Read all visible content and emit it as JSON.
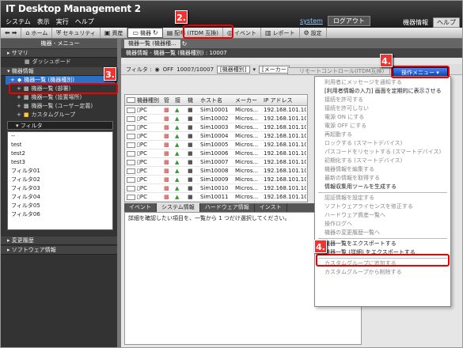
{
  "app": {
    "title": "IT Desktop Management 2",
    "menu": [
      "システム",
      "表示",
      "実行",
      "ヘルプ"
    ],
    "user": "system",
    "logout": "ログアウト",
    "device_info": "機器情報",
    "help": "ヘルプ"
  },
  "toolbar": {
    "home": "ホーム",
    "security": "セキュリティ",
    "assets": "資産",
    "devices": "機器",
    "distribution": "配布 (ITDM 互換)",
    "events": "イベント",
    "reports": "レポート",
    "settings": "設定"
  },
  "sidebar": {
    "header": "機器 - メニュー",
    "summary": "サマリ",
    "dashboard": "ダッシュボード",
    "device_info_section": "機器情報",
    "items": [
      {
        "label": "機器一覧 (機器種別)"
      },
      {
        "label": "機器一覧 (部署)"
      },
      {
        "label": "機器一覧 (設置場所)"
      },
      {
        "label": "機器一覧 (ユーザー定義)"
      },
      {
        "label": "カスタムグループ"
      }
    ],
    "filter_label": "フィルタ",
    "filters": [
      "--",
      "test",
      "test2",
      "test3",
      "フィルタ01",
      "フィルタ02",
      "フィルタ03",
      "フィルタ04",
      "フィルタ05",
      "フィルタ06"
    ],
    "change_history": "変更履歴",
    "software_info": "ソフトウェア情報"
  },
  "main": {
    "tab": "機器一覧 (機器種...",
    "info": "機器情報 - 機器一覧 (機器種別) : 10007",
    "filter_label": "フィルタ :",
    "filter_state": "OFF",
    "count": "10007/10007",
    "group": "[機器種別]",
    "maker": "[メーカー",
    "remote": "リモートコントロール(ITDM互換)",
    "op_menu": "操作メニュー",
    "columns": [
      "機器種別",
      "管",
      "接",
      "機",
      "ホスト名",
      "メーカー",
      "IP アドレス"
    ],
    "rows": [
      [
        "PC",
        "Sim10001",
        "Micros...",
        "192.168.101.10"
      ],
      [
        "PC",
        "Sim10002",
        "Micros...",
        "192.168.101.10"
      ],
      [
        "PC",
        "Sim10003",
        "Micros...",
        "192.168.101.10"
      ],
      [
        "PC",
        "Sim10004",
        "Micros...",
        "192.168.101.10"
      ],
      [
        "PC",
        "Sim10005",
        "Micros...",
        "192.168.101.10"
      ],
      [
        "PC",
        "Sim10006",
        "Micros...",
        "192.168.101.10"
      ],
      [
        "PC",
        "Sim10007",
        "Micros...",
        "192.168.101.10"
      ],
      [
        "PC",
        "Sim10008",
        "Micros...",
        "192.168.101.10"
      ],
      [
        "PC",
        "Sim10009",
        "Micros...",
        "192.168.101.10"
      ],
      [
        "PC",
        "Sim10010",
        "Micros...",
        "192.168.101.10"
      ],
      [
        "PC",
        "Sim10011",
        "Micros...",
        "192.168.101.10"
      ]
    ],
    "bottom_tabs": [
      "イベント",
      "システム情報",
      "ハードウェア情報",
      "インスト"
    ],
    "detail_msg": "詳細を確認したい項目を、一覧から 1 つだけ選択してください。"
  },
  "dropdown": [
    "利用者にメッセージを通知する",
    "[利用者情報の入力] 画面を定期的に表示させる",
    "接続を許可する",
    "接続を許可しない",
    "電源 ON にする",
    "電源 OFF にする",
    "再起動する",
    "ロックする (スマートデバイス)",
    "パスコードをリセットする (スマートデバイス)",
    "初期化する (スマートデバイス)",
    "機器情報を編集する",
    "最新の情報を取得する",
    "情報収集用ツールを生成する",
    "認証情報を設定する",
    "ソフトウェアライセンスを修正する",
    "ハードウェア資産一覧へ",
    "操作ログへ",
    "機器の変更履歴一覧へ",
    "機器一覧をエクスポートする",
    "機器一覧 (詳細) をエクスポートする",
    "カスタムグループに追加する",
    "カスタムグループから削除する"
  ],
  "callouts": [
    "2.",
    "3.",
    "4.",
    "4."
  ],
  "colors": {
    "selected": "#2a70c8",
    "callout": "#e00000",
    "titlebar": "#1c1c1c"
  }
}
